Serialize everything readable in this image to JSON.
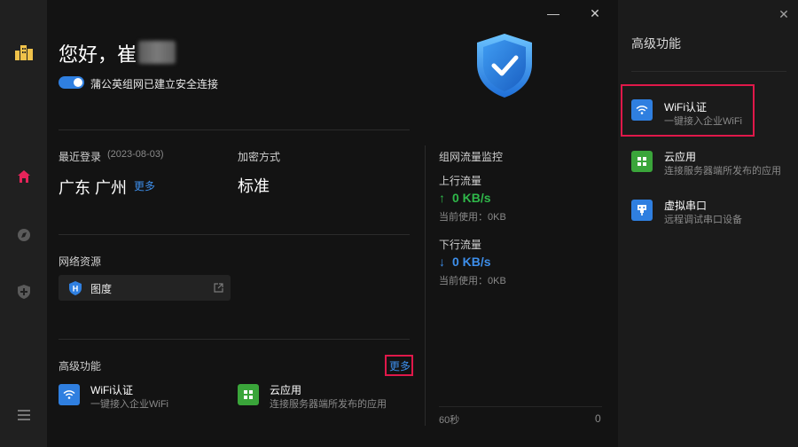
{
  "colors": {
    "accent": "#2f7fe0",
    "link": "#3d8eea",
    "up": "#2fb84a",
    "down": "#3d8eea",
    "highlight": "#e0184a",
    "cloud": "#3aa53a"
  },
  "sidebar": {
    "icons": [
      "buildings-icon",
      "home-icon",
      "compass-icon",
      "shield-plus-icon",
      "menu-icon"
    ]
  },
  "header": {
    "greeting": "您好，崔",
    "connection_status": "蒲公英组网已建立安全连接",
    "secure": true
  },
  "login": {
    "label": "最近登录",
    "date": "(2023-08-03)",
    "location": "广东 广州",
    "more": "更多"
  },
  "encryption": {
    "label": "加密方式",
    "value": "标准"
  },
  "resources": {
    "label": "网络资源",
    "items": [
      {
        "name": "图度",
        "badge": "H"
      }
    ]
  },
  "features": {
    "label": "高级功能",
    "more": "更多",
    "items": [
      {
        "title": "WiFi认证",
        "subtitle": "一键接入企业WiFi",
        "icon": "wifi-icon"
      },
      {
        "title": "云应用",
        "subtitle": "连接服务器端所发布的应用",
        "icon": "grid-icon"
      }
    ]
  },
  "traffic": {
    "title": "组网流量监控",
    "upload": {
      "label": "上行流量",
      "value": "0 KB/s",
      "used": "当前使用：0KB"
    },
    "download": {
      "label": "下行流量",
      "value": "0 KB/s",
      "used": "当前使用：0KB"
    },
    "axis_left": "60秒",
    "axis_right": "0"
  },
  "right_panel": {
    "title": "高级功能",
    "items": [
      {
        "title": "WiFi认证",
        "subtitle": "一键接入企业WiFi",
        "icon": "wifi-icon"
      },
      {
        "title": "云应用",
        "subtitle": "连接服务器端所发布的应用",
        "icon": "grid-icon"
      },
      {
        "title": "虚拟串口",
        "subtitle": "远程调试串口设备",
        "icon": "serial-port-icon"
      }
    ]
  },
  "window": {
    "minimize": "—",
    "close": "✕"
  }
}
